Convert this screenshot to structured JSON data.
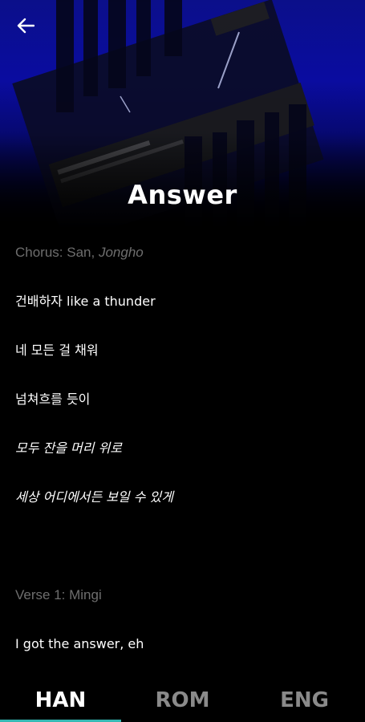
{
  "header": {
    "back_icon": "arrow-left-icon",
    "title": "Answer"
  },
  "lyrics": {
    "chorus_label": "Chorus: San, ",
    "chorus_label_italic": "Jongho",
    "chorus_lines": [
      "건배하자 like a thunder",
      "네 모든 걸 채워",
      "넘쳐흐를 듯이",
      "모두 잔을 머리 위로",
      "세상 어디에서든 보일 수 있게"
    ],
    "verse_label": "Verse 1: Mingi",
    "verse_lines": [
      "I got the answer, eh"
    ]
  },
  "tabs": [
    {
      "label": "HAN",
      "active": true
    },
    {
      "label": "ROM",
      "active": false
    },
    {
      "label": "ENG",
      "active": false
    }
  ],
  "colors": {
    "accent": "#35b9b4",
    "hero_blue": "#0a0ca0",
    "section_label": "#6e6e6e",
    "inactive_tab": "#8a8a8a"
  }
}
